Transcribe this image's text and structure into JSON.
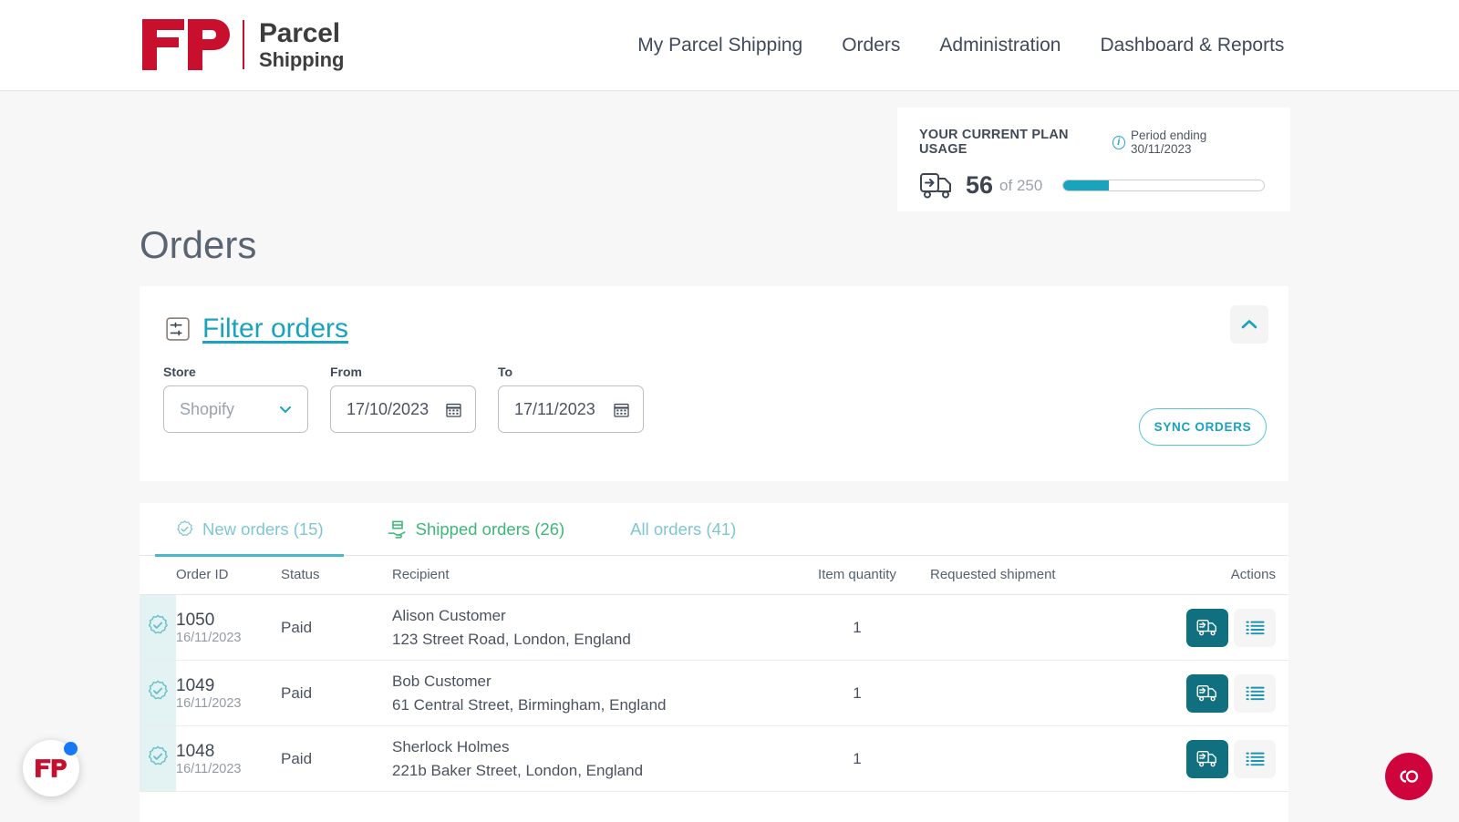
{
  "brand": {
    "mark": "FP",
    "name_line1": "Parcel",
    "name_line2": "Shipping",
    "red": "#c8102e",
    "teal": "#1aa3bd",
    "dark_teal": "#10707f",
    "green": "#3cb878"
  },
  "nav": {
    "items": [
      {
        "label": "My Parcel Shipping"
      },
      {
        "label": "Orders"
      },
      {
        "label": "Administration"
      },
      {
        "label": "Dashboard & Reports"
      }
    ]
  },
  "plan_usage": {
    "title": "YOUR CURRENT PLAN USAGE",
    "period": "Period ending 30/11/2023",
    "info_glyph": "i",
    "used": "56",
    "of_total": "of 250",
    "progress_percent": 22.4
  },
  "page": {
    "title": "Orders"
  },
  "filter": {
    "link_label": "Filter orders",
    "collapse_state": "expanded",
    "fields": {
      "store": {
        "label": "Store",
        "value": "Shopify",
        "options": [
          "Shopify"
        ]
      },
      "from": {
        "label": "From",
        "value": "17/10/2023"
      },
      "to": {
        "label": "To",
        "value": "17/11/2023"
      }
    },
    "sync_label": "SYNC ORDERS"
  },
  "tabs": [
    {
      "label": "New orders (15)",
      "icon": "check-badge-icon",
      "active": true
    },
    {
      "label": "Shipped orders (26)",
      "icon": "package-hand-icon",
      "active": false
    },
    {
      "label": "All orders (41)",
      "icon": "none",
      "active": false
    }
  ],
  "table": {
    "columns": [
      {
        "key": "flag",
        "label": ""
      },
      {
        "key": "id",
        "label": "Order ID"
      },
      {
        "key": "status",
        "label": "Status"
      },
      {
        "key": "recipient",
        "label": "Recipient"
      },
      {
        "key": "quantity",
        "label": "Item quantity"
      },
      {
        "key": "requested",
        "label": "Requested shipment"
      },
      {
        "key": "actions",
        "label": "Actions"
      }
    ],
    "rows": [
      {
        "order_id": "1050",
        "order_date": "16/11/2023",
        "status": "Paid",
        "recipient_name": "Alison Customer",
        "recipient_address": "123 Street Road, London, England",
        "quantity": "1",
        "requested_shipment": ""
      },
      {
        "order_id": "1049",
        "order_date": "16/11/2023",
        "status": "Paid",
        "recipient_name": "Bob Customer",
        "recipient_address": "61 Central Street,  Birmingham, England",
        "quantity": "1",
        "requested_shipment": ""
      },
      {
        "order_id": "1048",
        "order_date": "16/11/2023",
        "status": "Paid",
        "recipient_name": "Sherlock Holmes",
        "recipient_address": "221b Baker Street, London, England",
        "quantity": "1",
        "requested_shipment": ""
      }
    ]
  },
  "floating": {
    "chat_label": "FP",
    "cookie_label": "CO"
  }
}
